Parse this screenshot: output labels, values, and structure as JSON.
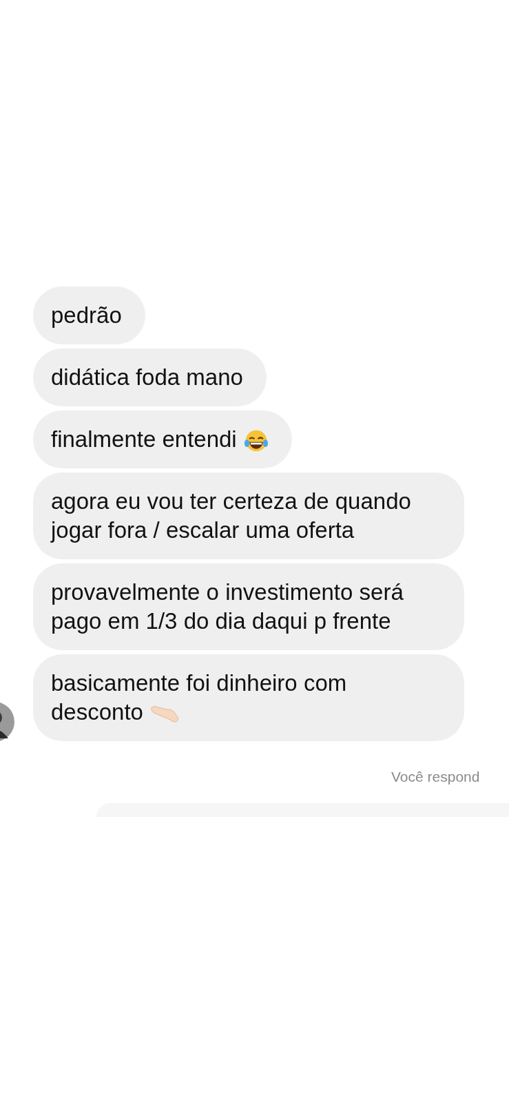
{
  "messages": [
    {
      "text": "pedrão",
      "kind": "plain",
      "avatar": false
    },
    {
      "text": "didática foda mano",
      "kind": "plain",
      "avatar": false
    },
    {
      "text": "finalmente entendi",
      "kind": "laughing",
      "avatar": false
    },
    {
      "text": "agora eu vou ter certeza de quando jogar fora / escalar uma oferta",
      "kind": "plain",
      "avatar": false
    },
    {
      "text": "provavelmente o investimento será pago em 1/3 do dia daqui p frente",
      "kind": "plain",
      "avatar": false
    },
    {
      "text": "basicamente foi dinheiro com desconto",
      "kind": "pointing",
      "avatar": true
    }
  ],
  "reply_note": "Você respond"
}
